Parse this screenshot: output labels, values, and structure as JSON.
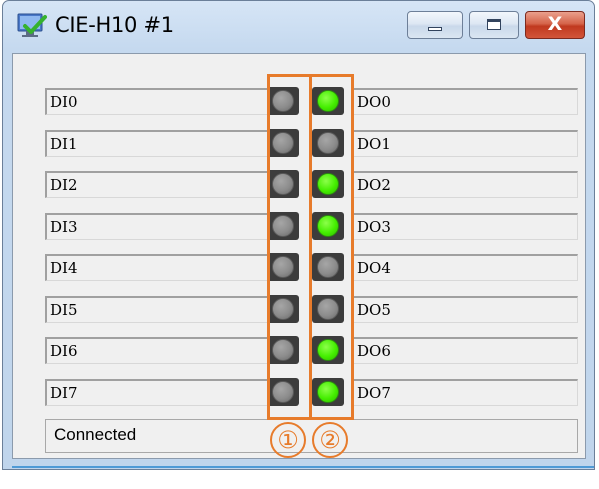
{
  "window": {
    "title": "CIE-H10 #1",
    "icons": {
      "app": "network-check-icon",
      "minimize": "minimize-icon",
      "maximize": "maximize-icon",
      "close": "close-icon"
    },
    "close_glyph": "X"
  },
  "inputs": [
    {
      "label": "DI0",
      "on": false
    },
    {
      "label": "DI1",
      "on": false
    },
    {
      "label": "DI2",
      "on": false
    },
    {
      "label": "DI3",
      "on": false
    },
    {
      "label": "DI4",
      "on": false
    },
    {
      "label": "DI5",
      "on": false
    },
    {
      "label": "DI6",
      "on": false
    },
    {
      "label": "DI7",
      "on": false
    }
  ],
  "outputs": [
    {
      "label": "DO0",
      "on": true
    },
    {
      "label": "DO1",
      "on": false
    },
    {
      "label": "DO2",
      "on": true
    },
    {
      "label": "DO3",
      "on": true
    },
    {
      "label": "DO4",
      "on": false
    },
    {
      "label": "DO5",
      "on": false
    },
    {
      "label": "DO6",
      "on": true
    },
    {
      "label": "DO7",
      "on": true
    }
  ],
  "status": "Connected",
  "annotations": {
    "callout_1": "①",
    "callout_2": "②",
    "color": "#e77b2b"
  },
  "colors": {
    "led_on": "#44ee00",
    "led_off": "#8c8c8c",
    "highlight": "#e77b2b"
  }
}
